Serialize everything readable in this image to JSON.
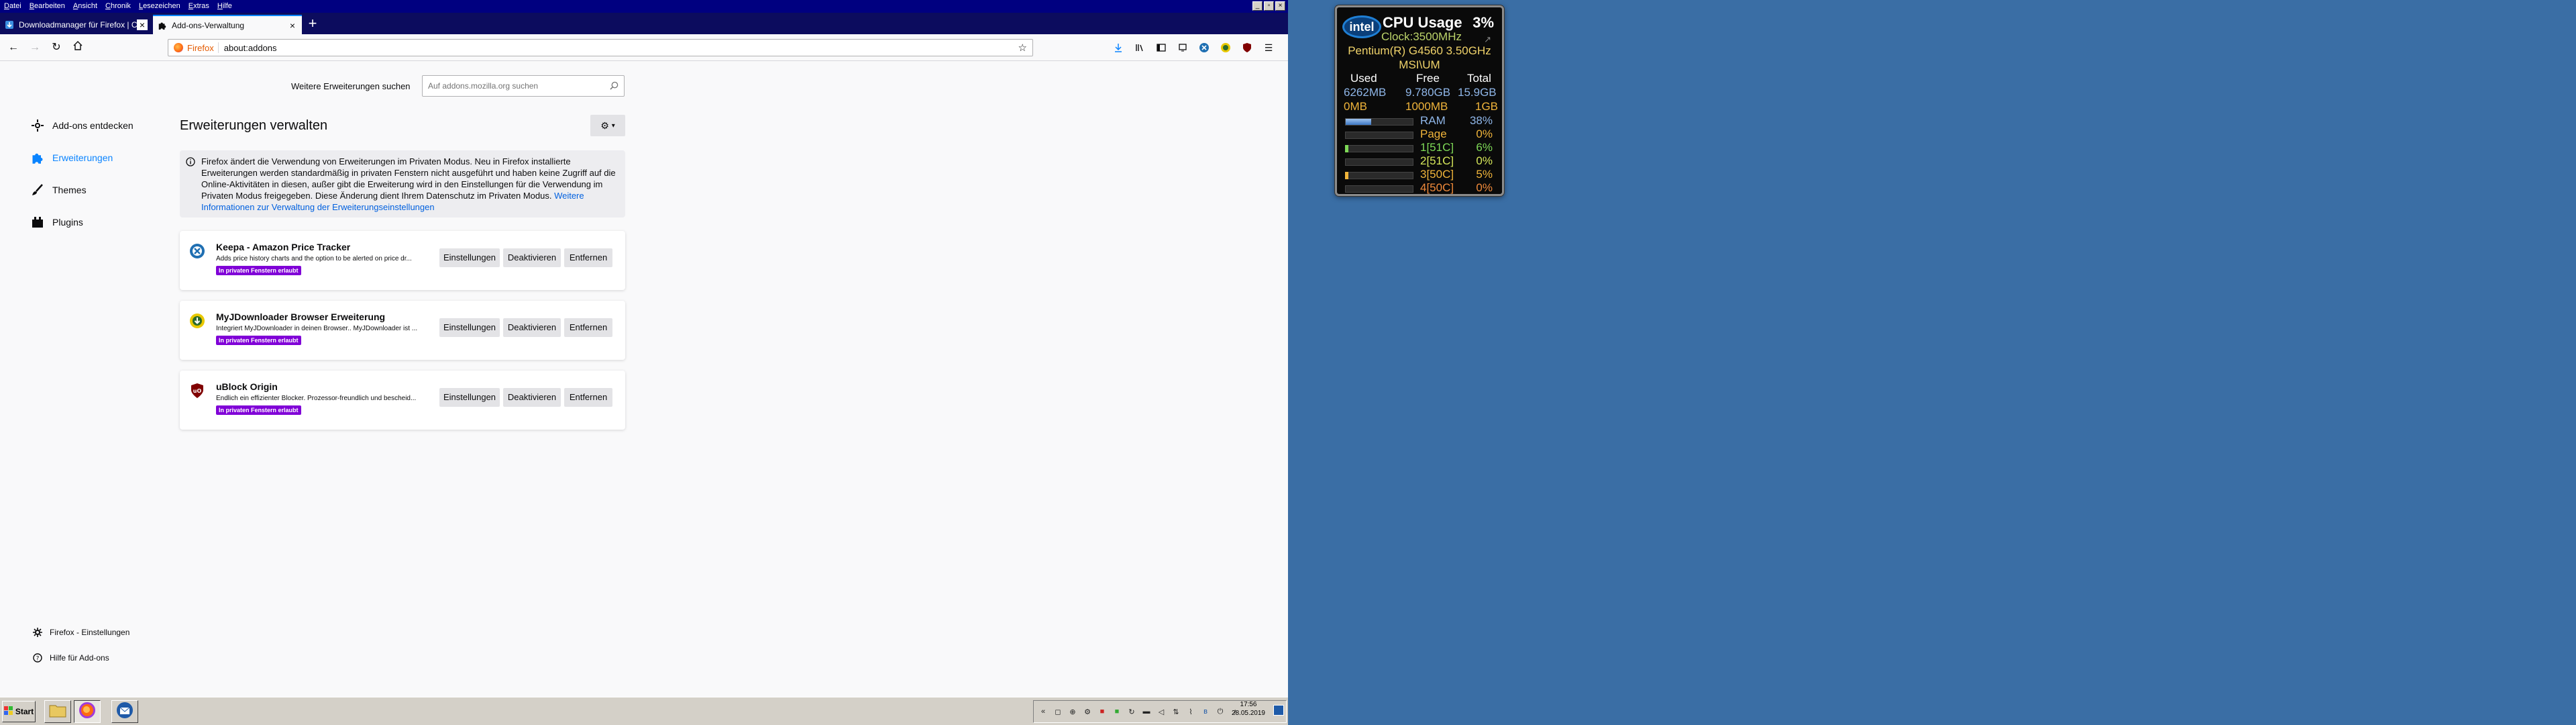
{
  "menubar": {
    "items": [
      {
        "u": "D",
        "rest": "atei"
      },
      {
        "u": "B",
        "rest": "earbeiten"
      },
      {
        "u": "A",
        "rest": "nsicht"
      },
      {
        "u": "C",
        "rest": "hronik"
      },
      {
        "u": "L",
        "rest": "esezeichen"
      },
      {
        "u": "E",
        "rest": "xtras"
      },
      {
        "u": "H",
        "rest": "ilfe"
      }
    ]
  },
  "tabs": [
    {
      "title": "Downloadmanager für Firefox | Co",
      "active": false,
      "close": "×"
    },
    {
      "title": "Add-ons-Verwaltung",
      "active": true,
      "close": "×"
    }
  ],
  "newtab": "+",
  "urlbar": {
    "identity": "Firefox",
    "url": "about:addons"
  },
  "search": {
    "label": "Weitere Erweiterungen suchen",
    "placeholder": "Auf addons.mozilla.org suchen"
  },
  "sidebar": {
    "items": [
      {
        "label": "Add-ons entdecken",
        "selected": false
      },
      {
        "label": "Erweiterungen",
        "selected": true
      },
      {
        "label": "Themes",
        "selected": false
      },
      {
        "label": "Plugins",
        "selected": false
      }
    ],
    "footer": [
      {
        "label": "Firefox - Einstellungen"
      },
      {
        "label": "Hilfe für Add-ons"
      }
    ]
  },
  "main": {
    "title": "Erweiterungen verwalten",
    "notice": {
      "text": "Firefox ändert die Verwendung von Erweiterungen im Privaten Modus. Neu in Firefox installierte Erweiterungen werden standardmäßig in privaten Fenstern nicht ausgeführt und haben keine Zugriff auf die Online-Aktivitäten in diesen, außer gibt die Erweiterung wird in den Einstellungen für die Verwendung im Privaten Modus freigegeben. Diese Änderung dient Ihrem Datenschutz im Privaten Modus. ",
      "link": "Weitere Informationen zur Verwaltung der Erweiterungseinstellungen"
    },
    "addons": [
      {
        "name": "Keepa - Amazon Price Tracker",
        "description": "Adds price history charts and the option to be alerted on price dr...",
        "badge": "In privaten Fenstern erlaubt",
        "buttons": [
          "Einstellungen",
          "Deaktivieren",
          "Entfernen"
        ]
      },
      {
        "name": "MyJDownloader Browser Erweiterung",
        "description": "Integriert MyJDownloader in deinen Browser.. MyJDownloader ist ...",
        "badge": "In privaten Fenstern erlaubt",
        "buttons": [
          "Einstellungen",
          "Deaktivieren",
          "Entfernen"
        ]
      },
      {
        "name": "uBlock Origin",
        "description": "Endlich ein effizienter Blocker. Prozessor-freundlich und bescheid...",
        "badge": "In privaten Fenstern erlaubt",
        "buttons": [
          "Einstellungen",
          "Deaktivieren",
          "Entfernen"
        ]
      }
    ]
  },
  "taskbar": {
    "start": "Start",
    "clock": {
      "time": "17:56",
      "date": "28.05.2019"
    }
  },
  "gadget": {
    "logo": "intel",
    "title": "CPU Usage",
    "percent": "3%",
    "clock": "Clock:3500MHz",
    "cpu": "Pentium(R) G4560 3.50GHz",
    "board": "MSI\\UM",
    "mem_headers": [
      "Used",
      "Free",
      "Total"
    ],
    "mem_row1": [
      "6262MB",
      "9.780GB",
      "15.9GB"
    ],
    "mem_row2": [
      "0MB",
      "1000MB",
      "1GB"
    ],
    "ram": {
      "label": "RAM",
      "value": "38%",
      "level": 0.38
    },
    "page": {
      "label": "Page",
      "value": "0%",
      "level": 0
    },
    "cores": [
      {
        "label": "1[51C]",
        "value": "6%",
        "level": 0.06,
        "color": "#7ed957"
      },
      {
        "label": "2[51C]",
        "value": "0%",
        "level": 0,
        "color": "#d7e85a"
      },
      {
        "label": "3[50C]",
        "value": "5%",
        "level": 0.05,
        "color": "#f0b43a"
      },
      {
        "label": "4[50C]",
        "value": "0%",
        "level": 0,
        "color": "#f08a3a"
      }
    ]
  }
}
